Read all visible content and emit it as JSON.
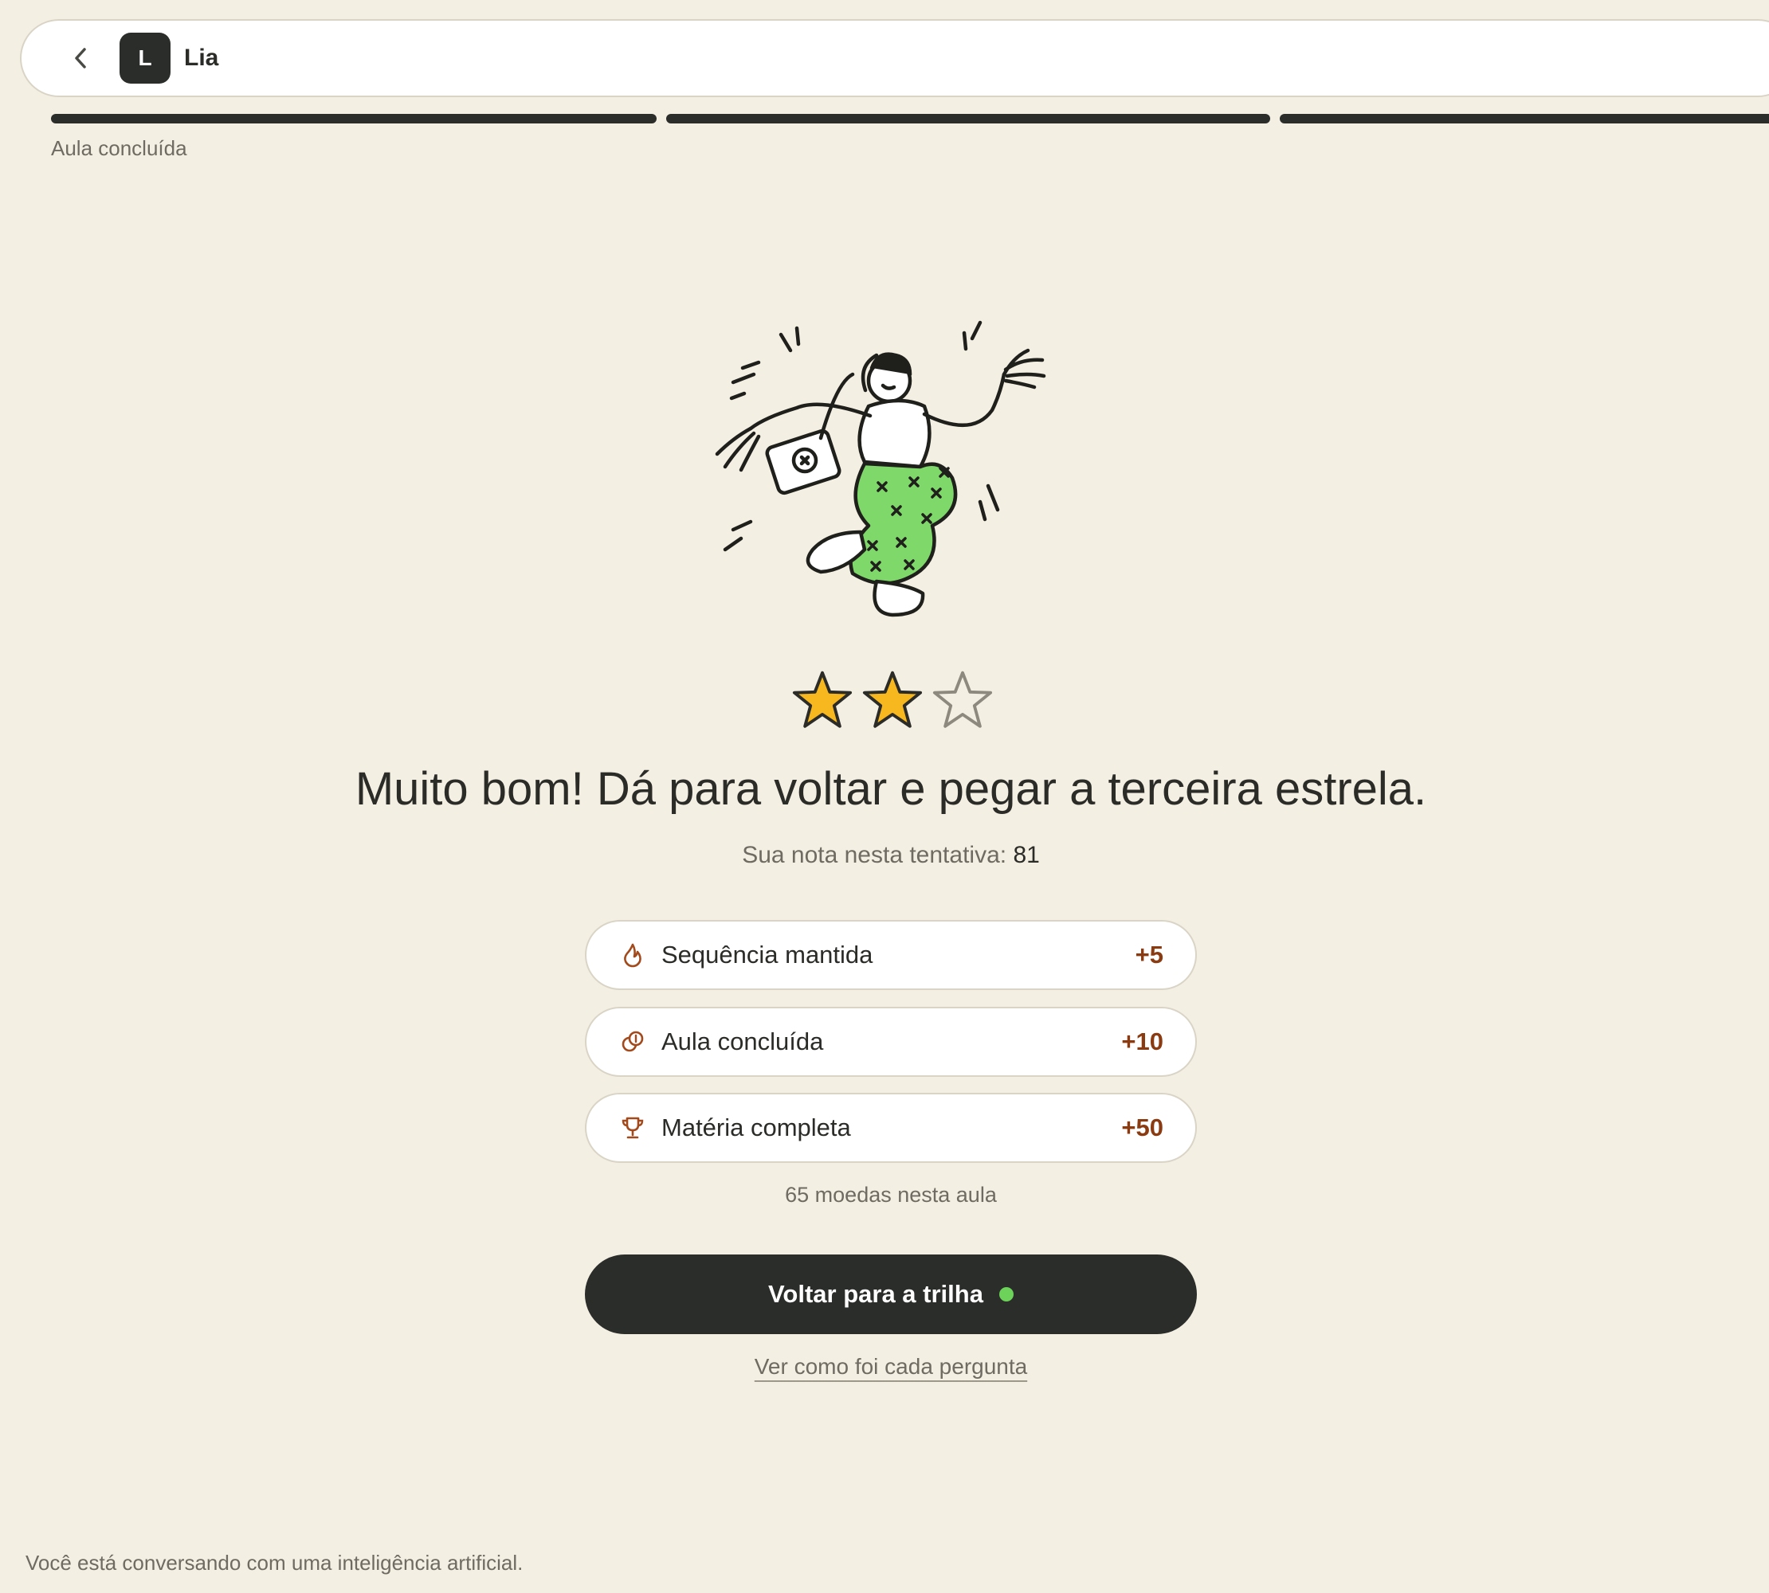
{
  "header": {
    "back_icon": "chevron-left-icon",
    "avatar_letter": "L",
    "tutor_name": "Lia"
  },
  "progress": {
    "segments_total": 3,
    "segments_complete": 3,
    "status_label": "Aula concluída"
  },
  "result": {
    "stars_earned": 2,
    "stars_total": 3,
    "headline": "Muito bom! Dá para voltar e pegar a terceira estrela.",
    "score_label": "Sua nota nesta tentativa:",
    "score_value": "81"
  },
  "rewards": [
    {
      "icon": "flame-icon",
      "label": "Sequência mantida",
      "value": "+5"
    },
    {
      "icon": "coins-icon",
      "label": "Aula concluída",
      "value": "+10"
    },
    {
      "icon": "trophy-icon",
      "label": "Matéria completa",
      "value": "+50"
    }
  ],
  "coins_summary": "65 moedas nesta aula",
  "actions": {
    "primary_label": "Voltar para a trilha",
    "secondary_label": "Ver como foi cada pergunta"
  },
  "footer_note": "Você está conversando com uma inteligência artificial.",
  "colors": {
    "background": "#f4efe3",
    "dark": "#2b2d2a",
    "star_fill": "#f7b71e",
    "reward_value": "#8a3b12",
    "accent_green": "#6cd25a",
    "illustration_green": "#7fd86a"
  }
}
